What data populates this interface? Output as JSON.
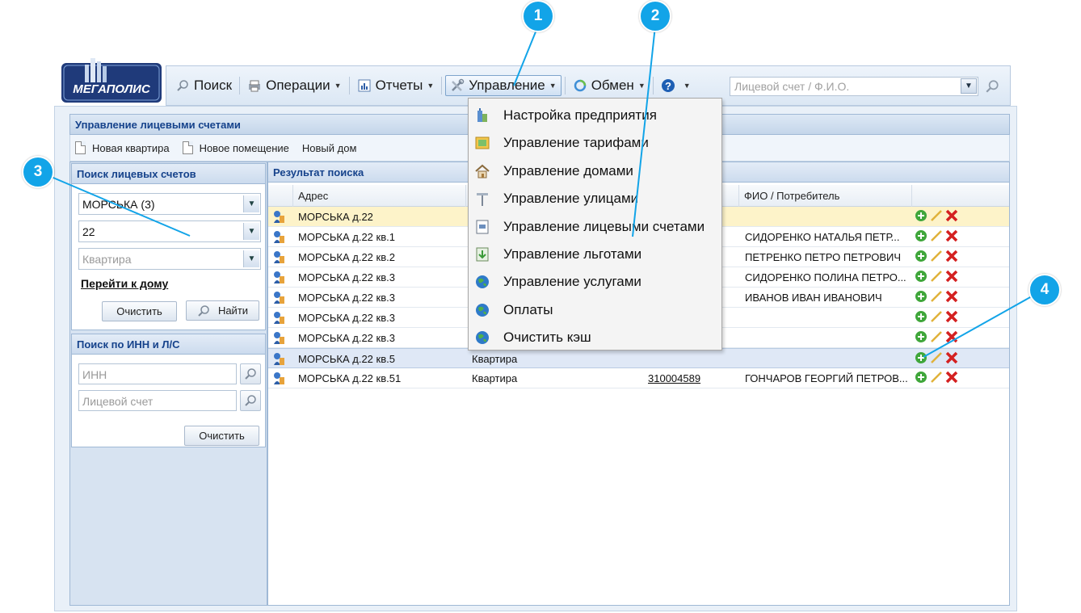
{
  "logo": {
    "text": "МЕГАПОЛИС"
  },
  "toolbar": {
    "search": "Поиск",
    "operations": "Операции",
    "reports": "Отчеты",
    "management": "Управление",
    "exchange": "Обмен",
    "help_icon": "question-icon",
    "search_placeholder": "Лицевой счет / Ф.И.О."
  },
  "panel": {
    "title": "Управление лицевыми счетами",
    "actions": [
      "Новая квартира",
      "Новое помещение",
      "Новый дом"
    ]
  },
  "sidebar": {
    "account_search": {
      "title": "Поиск лицевых счетов",
      "street": "МОРСЬКА (3)",
      "house": "22",
      "apartment_placeholder": "Квартира",
      "goto_house": "Перейти к дому",
      "clear": "Очистить",
      "find": "Найти"
    },
    "inn_search": {
      "title": "Поиск по ИНН и Л/С",
      "inn_placeholder": "ИНН",
      "account_placeholder": "Лицевой счет",
      "clear": "Очистить"
    }
  },
  "results": {
    "title": "Результат поиска",
    "columns": {
      "address": "Адрес",
      "fio": "ФИО / Потребитель"
    },
    "rows": [
      {
        "address": "МОРСЬКА д.22",
        "type": "",
        "account": "",
        "fio": "",
        "state": "selected"
      },
      {
        "address": "МОРСЬКА д.22 кв.1",
        "type": "",
        "account": "",
        "fio": "СИДОРЕНКО НАТАЛЬЯ ПЕТР...",
        "state": ""
      },
      {
        "address": "МОРСЬКА д.22 кв.2",
        "type": "",
        "account": "",
        "fio": "ПЕТРЕНКО ПЕТРО ПЕТРОВИЧ",
        "state": ""
      },
      {
        "address": "МОРСЬКА д.22 кв.3",
        "type": "",
        "account": "",
        "fio": "СИДОРЕНКО ПОЛИНА ПЕТРО...",
        "state": ""
      },
      {
        "address": "МОРСЬКА д.22 кв.3",
        "type": "",
        "account": "",
        "fio": "ИВАНОВ ИВАН ИВАНОВИЧ",
        "state": ""
      },
      {
        "address": "МОРСЬКА д.22 кв.3",
        "type": "",
        "account": "",
        "fio": "",
        "state": ""
      },
      {
        "address": "МОРСЬКА д.22 кв.3",
        "type": "",
        "account": "",
        "fio": "",
        "state": ""
      },
      {
        "address": "МОРСЬКА д.22 кв.5",
        "type": "Квартира",
        "account": "",
        "fio": "",
        "state": "hover"
      },
      {
        "address": "МОРСЬКА д.22 кв.51",
        "type": "Квартира",
        "account": "310004589",
        "fio": "ГОНЧАРОВ ГЕОРГИЙ ПЕТРОВ...",
        "state": ""
      }
    ]
  },
  "menu": {
    "items": [
      {
        "label": "Настройка предприятия",
        "icon": "building-icon"
      },
      {
        "label": "Управление тарифами",
        "icon": "tariff-icon"
      },
      {
        "label": "Управление домами",
        "icon": "house-icon"
      },
      {
        "label": "Управление улицами",
        "icon": "street-sign-icon"
      },
      {
        "label": "Управление лицевыми счетами",
        "icon": "account-card-icon"
      },
      {
        "label": "Управление льготами",
        "icon": "benefit-download-icon"
      },
      {
        "label": "Управление услугами",
        "icon": "globe-icon"
      },
      {
        "label": "Оплаты",
        "icon": "globe-icon"
      },
      {
        "label": "Очистить кэш",
        "icon": "globe-icon"
      }
    ]
  },
  "callouts": [
    "1",
    "2",
    "3",
    "4"
  ],
  "colors": {
    "callout": "#12a4e8",
    "header_text": "#15428b",
    "selected_row": "#fdf3c9"
  }
}
